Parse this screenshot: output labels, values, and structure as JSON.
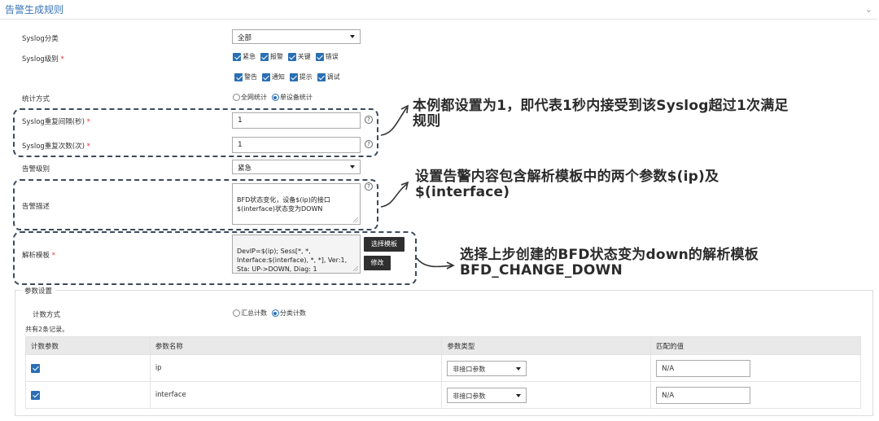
{
  "section": {
    "title": "告警生成规则",
    "collapse_icon": "chevron-down-icon"
  },
  "syslog_category": {
    "label": "Syslog分类",
    "value": "全部"
  },
  "syslog_level": {
    "label": "Syslog级别",
    "required": "*",
    "options": [
      {
        "label": "紧急",
        "checked": true
      },
      {
        "label": "报警",
        "checked": true
      },
      {
        "label": "关键",
        "checked": true
      },
      {
        "label": "错误",
        "checked": true
      },
      {
        "label": "警告",
        "checked": true
      },
      {
        "label": "通知",
        "checked": true
      },
      {
        "label": "提示",
        "checked": true
      },
      {
        "label": "调试",
        "checked": true
      }
    ]
  },
  "stat_method": {
    "label": "统计方式",
    "options": [
      "全网统计",
      "单设备统计"
    ],
    "selected": "单设备统计"
  },
  "repeat_interval": {
    "label": "Syslog重复间隔(秒)",
    "required": "*",
    "value": "1",
    "help": "?"
  },
  "repeat_count": {
    "label": "Syslog重复次数(次)",
    "required": "*",
    "value": "1",
    "help": "?"
  },
  "alarm_level": {
    "label": "告警级别",
    "value": "紧急"
  },
  "alarm_desc": {
    "label": "告警描述",
    "value": "BFD状态变化，设备$(ip)的接口\n$(interface)状态变为DOWN",
    "help": "?"
  },
  "parse_template": {
    "label": "解析模板",
    "required": "*",
    "value": "DevIP=$(ip); Sess[*, *,\nInterface:$(interface), *, *], Ver:1,\nSta: UP->DOWN, Diag: 1",
    "select_button": "选择模板",
    "edit_button": "修改"
  },
  "annotations": [
    {
      "line1": "本例都设置为1，即代表1秒内接受到该Syslog超过1次满足",
      "line2": "规则"
    },
    {
      "line1": "设置告警内容包含解析模板中的两个参数$(ip)及",
      "line2": "$(interface)"
    },
    {
      "line1": "选择上步创建的BFD状态变为down的解析模板",
      "line2": "BFD_CHANGE_DOWN"
    }
  ],
  "params": {
    "legend": "参数设置",
    "count_method": {
      "label": "计数方式",
      "options": [
        "汇总计数",
        "分类计数"
      ],
      "selected": "分类计数"
    },
    "record_count": "共有2条记录。",
    "columns": [
      "计数参数",
      "参数名称",
      "参数类型",
      "匹配的值"
    ],
    "rows": [
      {
        "checked": true,
        "name": "ip",
        "type": "非接口参数",
        "match": "N/A"
      },
      {
        "checked": true,
        "name": "interface",
        "type": "非接口参数",
        "match": "N/A"
      }
    ]
  },
  "colors": {
    "accent": "#2a6fb3",
    "title": "#3a74b8",
    "dash": "#3d4a5c"
  }
}
